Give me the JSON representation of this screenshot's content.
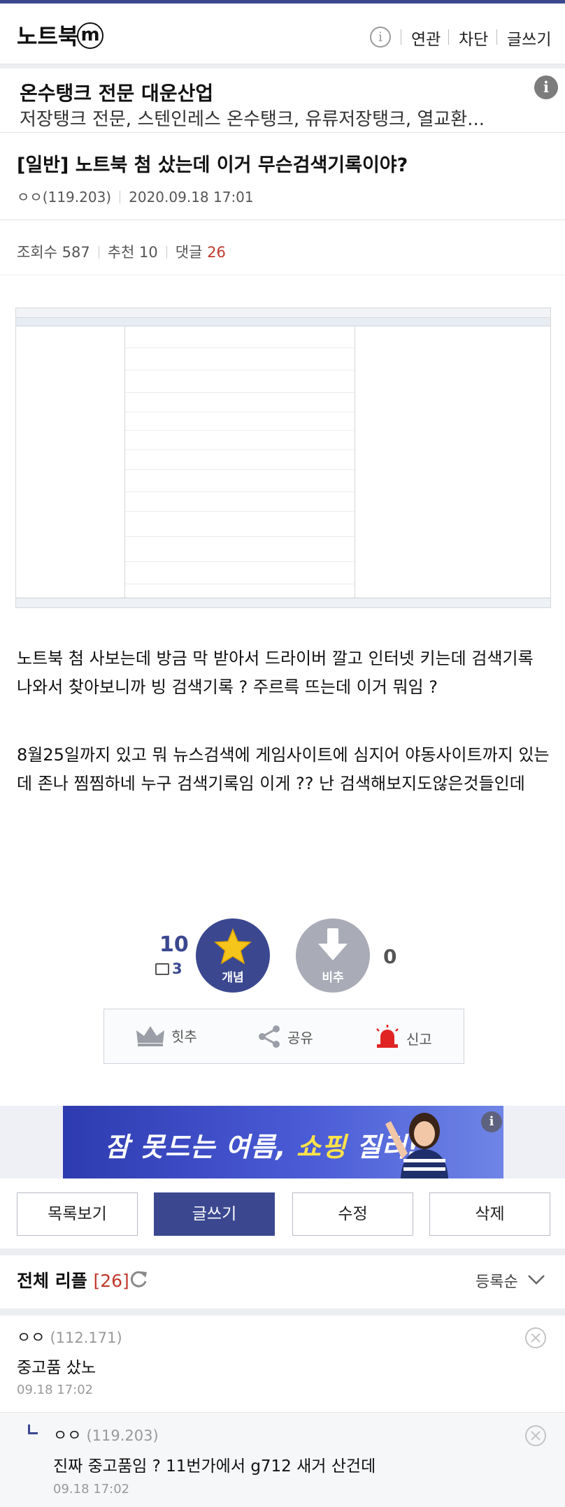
{
  "header": {
    "gallery_title": "노트북",
    "badge_letter": "m",
    "info_glyph": "i",
    "links": [
      "연관",
      "차단",
      "글쓰기"
    ]
  },
  "ad_text": {
    "title": "온수탱크 전문 대운산업",
    "description": "저장탱크 전문, 스텐인레스 온수탱크, 유류저장탱크, 열교환...",
    "info_glyph": "i"
  },
  "post": {
    "title": "[일반] 노트북 첨 샀는데 이거 무슨검색기록이야?",
    "author": "ㅇㅇ(119.203)",
    "datetime": "2020.09.18 17:01",
    "views_label": "조회수 587",
    "recommend_label": "추천 10",
    "comments_label": "댓글",
    "comments_count": "26",
    "paragraphs": [
      "노트북 첨 사보는데 방금 막 받아서 드라이버 깔고 인터넷 키는데 검색기록 나와서 찾아보니까 빙 검색기록 ? 주르륵 뜨는데 이거 뭐임 ?",
      "8월25일까지 있고 뭐 뉴스검색에 게임사이트에 심지어 야동사이트까지 있는데 존나 찜찜하네 누구 검색기록임 이게 ?? 난 검색해보지도않은것들인데"
    ]
  },
  "vote": {
    "up_count": "10",
    "fixed_count": "3",
    "up_label": "개념",
    "down_label": "비추",
    "down_count": "0",
    "actions": [
      "힛추",
      "공유",
      "신고"
    ]
  },
  "banner": {
    "text_prefix": "잠 못드는 여름,",
    "text_highlight": "쇼핑",
    "text_suffix": "질러!",
    "info_glyph": "i"
  },
  "buttons": [
    "목록보기",
    "글쓰기",
    "수정",
    "삭제"
  ],
  "comments_header": {
    "title": "전체 리플",
    "count": "[26]",
    "sort_label": "등록순"
  },
  "comments": [
    {
      "author": "ㅇㅇ",
      "ip": "(112.171)",
      "text": "중고품 샀노",
      "time": "09.18 17:02"
    },
    {
      "author": "ㅇㅇ",
      "ip": "(119.203)",
      "text": "진짜 중고품임 ? 11번가에서 g712 새거 산건데",
      "time": "09.18 17:02"
    }
  ],
  "colors": {
    "brand": "#3b4890",
    "recommend_red": "#c0392b",
    "vote_down_gray": "#a9acb6",
    "star_yellow": "#f6c51b"
  }
}
